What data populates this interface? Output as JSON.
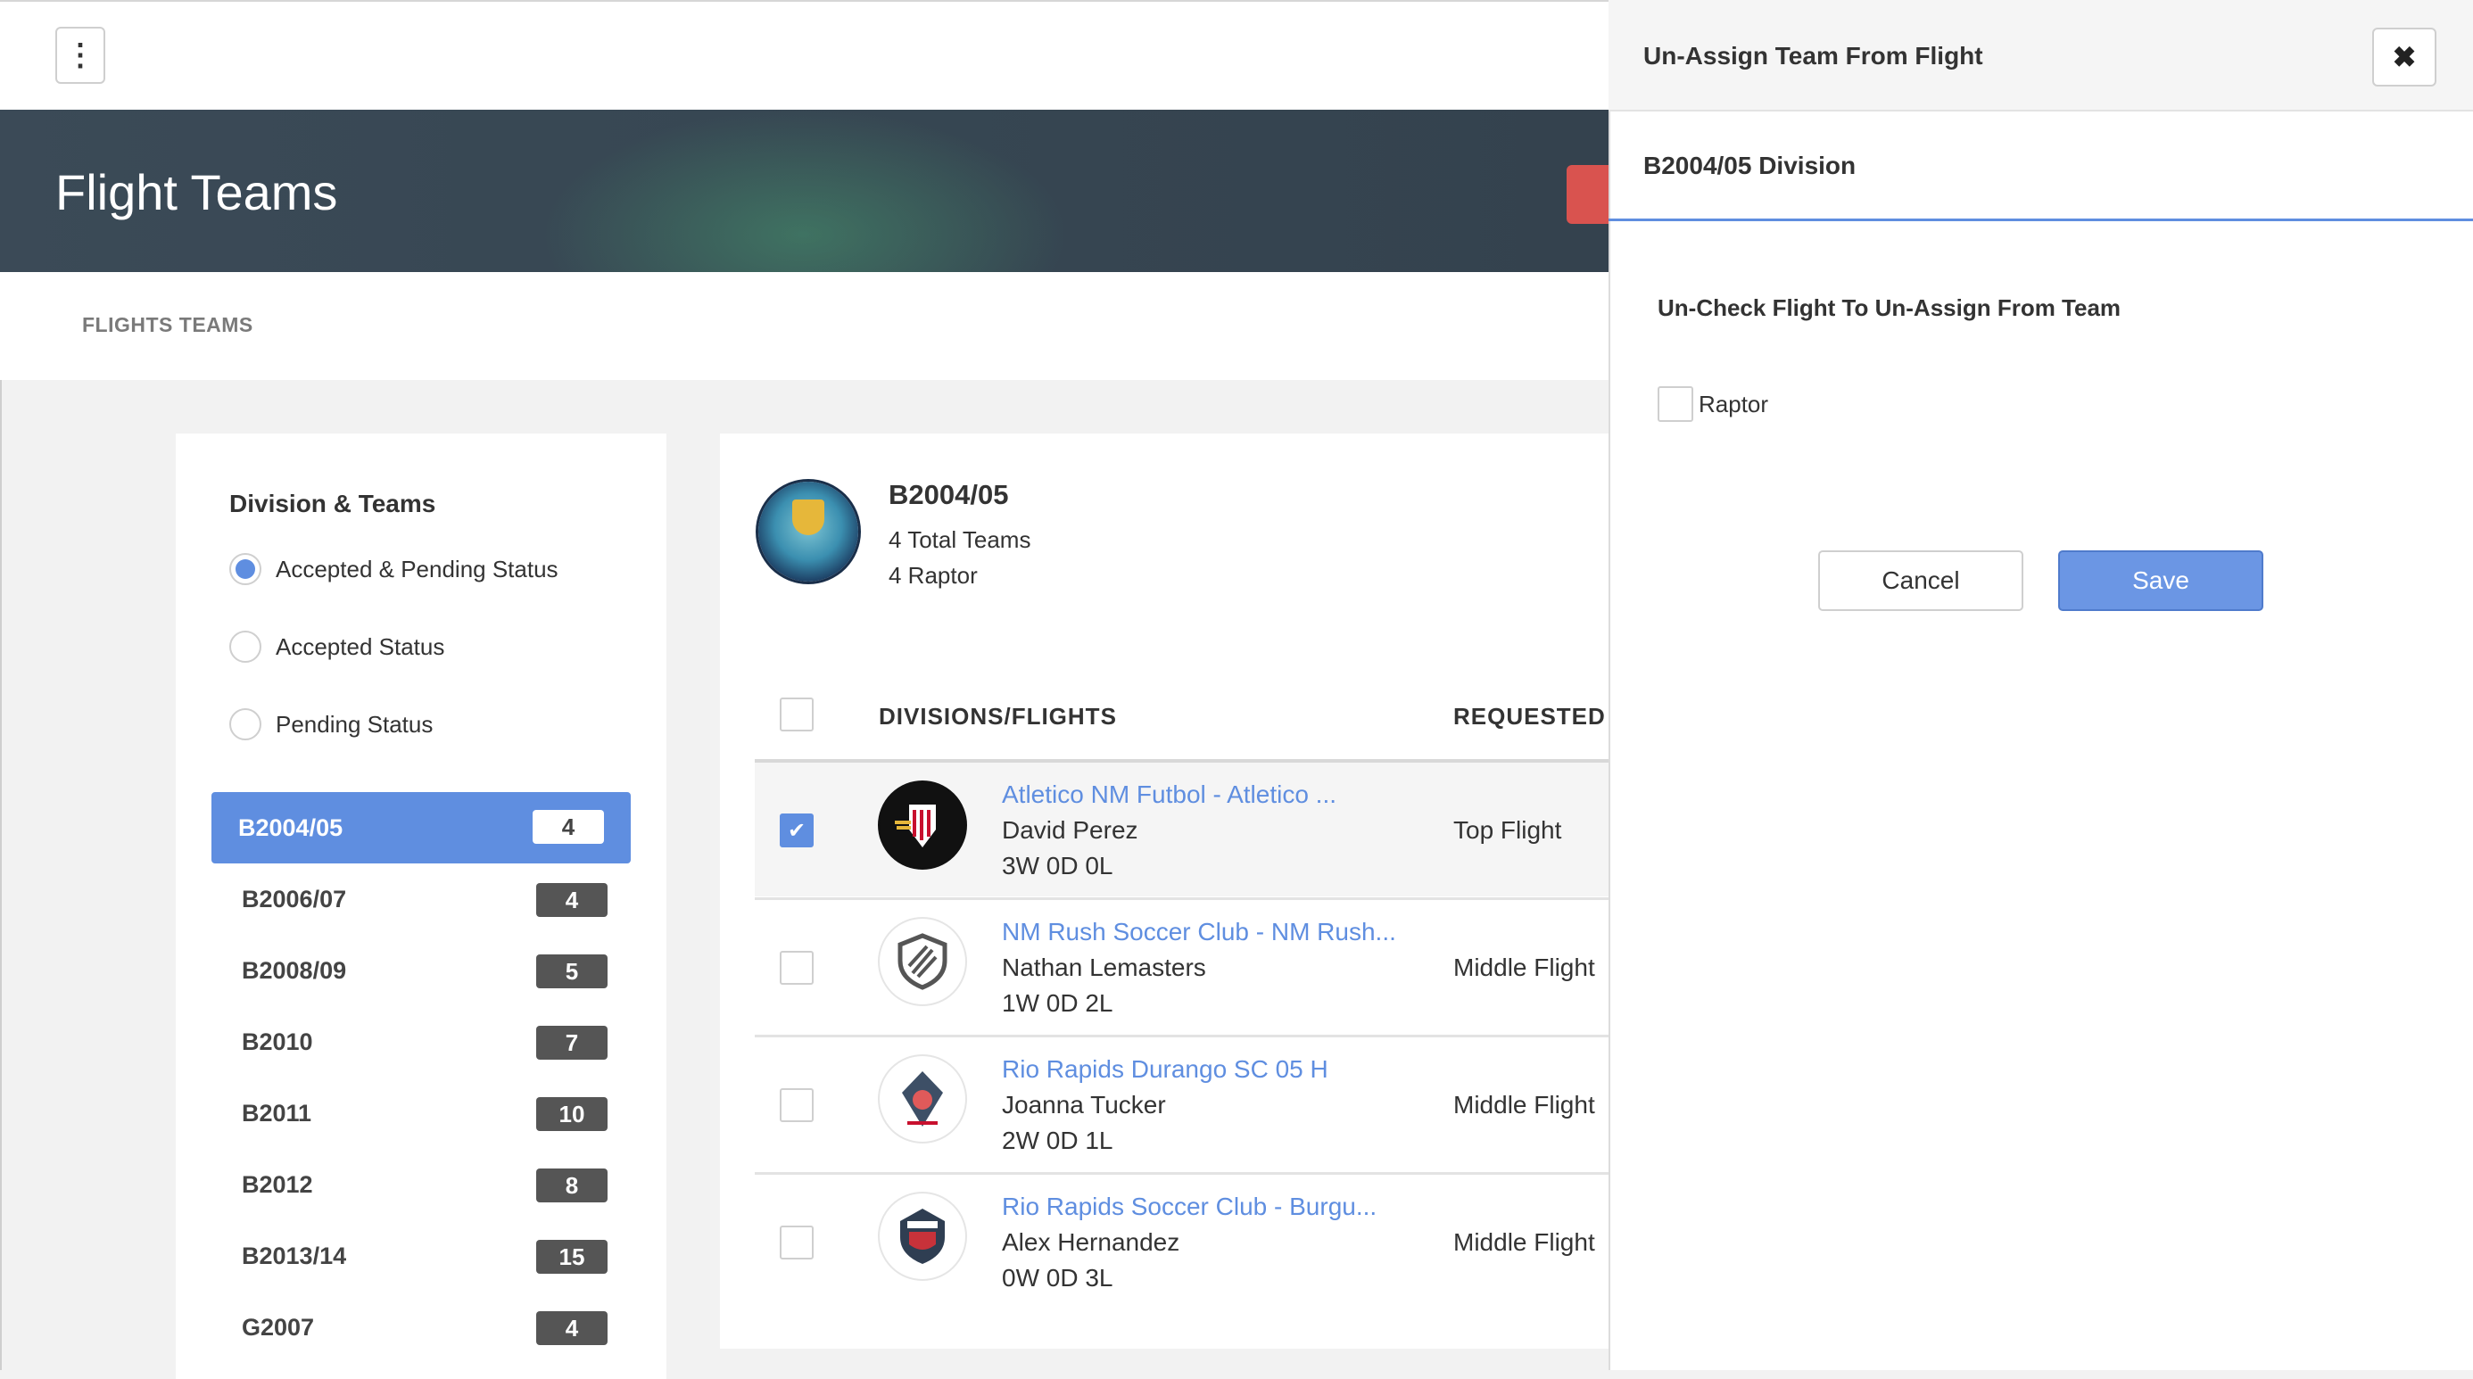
{
  "header": {
    "menu_icon": "more-vertical-icon",
    "page_title": "Flight Teams",
    "breadcrumb": "FLIGHTS TEAMS"
  },
  "sidebar": {
    "title": "Division & Teams",
    "filters": [
      {
        "label": "Accepted & Pending Status",
        "selected": true
      },
      {
        "label": "Accepted Status",
        "selected": false
      },
      {
        "label": "Pending Status",
        "selected": false
      }
    ],
    "divisions": [
      {
        "name": "B2004/05",
        "count": "4",
        "active": true
      },
      {
        "name": "B2006/07",
        "count": "4"
      },
      {
        "name": "B2008/09",
        "count": "5"
      },
      {
        "name": "B2010",
        "count": "7"
      },
      {
        "name": "B2011",
        "count": "10"
      },
      {
        "name": "B2012",
        "count": "8"
      },
      {
        "name": "B2013/14",
        "count": "15"
      },
      {
        "name": "G2007",
        "count": "4"
      }
    ]
  },
  "main": {
    "division_title": "B2004/05",
    "total_teams": "4 Total Teams",
    "flight_count": "4 Raptor",
    "columns": [
      "DIVISIONS/FLIGHTS",
      "REQUESTED"
    ],
    "rows": [
      {
        "team": "Atletico NM Futbol - Atletico ...",
        "coach": "David Perez",
        "record": "3W 0D 0L",
        "requested": "Top Flight",
        "checked": true
      },
      {
        "team": "NM Rush Soccer Club - NM Rush...",
        "coach": "Nathan Lemasters",
        "record": "1W 0D 2L",
        "requested": "Middle Flight",
        "checked": false
      },
      {
        "team": "Rio Rapids Durango SC 05 H",
        "coach": "Joanna Tucker",
        "record": "2W 0D 1L",
        "requested": "Middle Flight",
        "checked": false
      },
      {
        "team": "Rio Rapids Soccer Club - Burgu...",
        "coach": "Alex Hernandez",
        "record": "0W 0D 3L",
        "requested": "Middle Flight",
        "checked": false
      }
    ]
  },
  "drawer": {
    "title": "Un-Assign Team From Flight",
    "close_icon": "close-icon",
    "division": "B2004/05 Division",
    "instruction": "Un-Check Flight To Un-Assign From Team",
    "flight_option": "Raptor",
    "cancel_label": "Cancel",
    "save_label": "Save"
  },
  "colors": {
    "accent": "#5f8ee0",
    "hero_bg": "#374753",
    "badge": "#555555",
    "danger": "#d9534f"
  }
}
